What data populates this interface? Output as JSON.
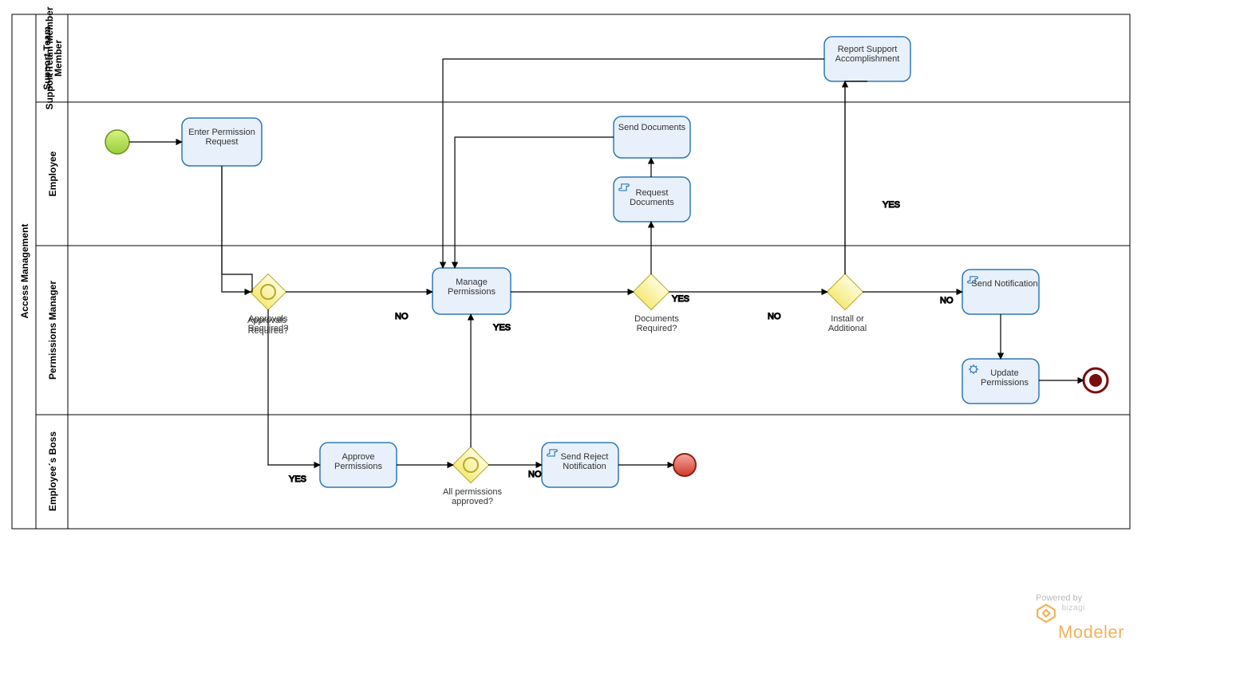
{
  "pool": {
    "name": "Access Management"
  },
  "lanes": [
    {
      "id": "support",
      "title": "Support Team Member"
    },
    {
      "id": "employee",
      "title": "Employee"
    },
    {
      "id": "pm",
      "title": "Permissions Manager"
    },
    {
      "id": "boss",
      "title": "Employee´s Boss"
    }
  ],
  "tasks": {
    "enterPermission": {
      "label": "Enter Permission Request"
    },
    "reportSupport": {
      "label": "Report Support Accomplishment"
    },
    "sendDocuments": {
      "label": "Send Documents"
    },
    "requestDocuments": {
      "label": "Request Documents"
    },
    "managePermissions": {
      "label": "Manage Permissions"
    },
    "sendNotification": {
      "label": "Send Notification"
    },
    "updatePermissions": {
      "label": "Update Permissions"
    },
    "approvePermissions": {
      "label": "Approve Permissions"
    },
    "sendReject": {
      "label": "Send Reject Notification"
    }
  },
  "gateways": {
    "approvalsRequired": {
      "label": "Approvals Required?"
    },
    "documentsRequired": {
      "label": "Documents Required?"
    },
    "installAdditional": {
      "label": "Install or Additional"
    },
    "allApproved": {
      "label": "All permissions approved?"
    }
  },
  "edgeLabels": {
    "no": "NO",
    "yes": "YES"
  },
  "footer": {
    "poweredBy": "Powered by",
    "brandSmall": "bizagi",
    "brand": "Modeler"
  }
}
